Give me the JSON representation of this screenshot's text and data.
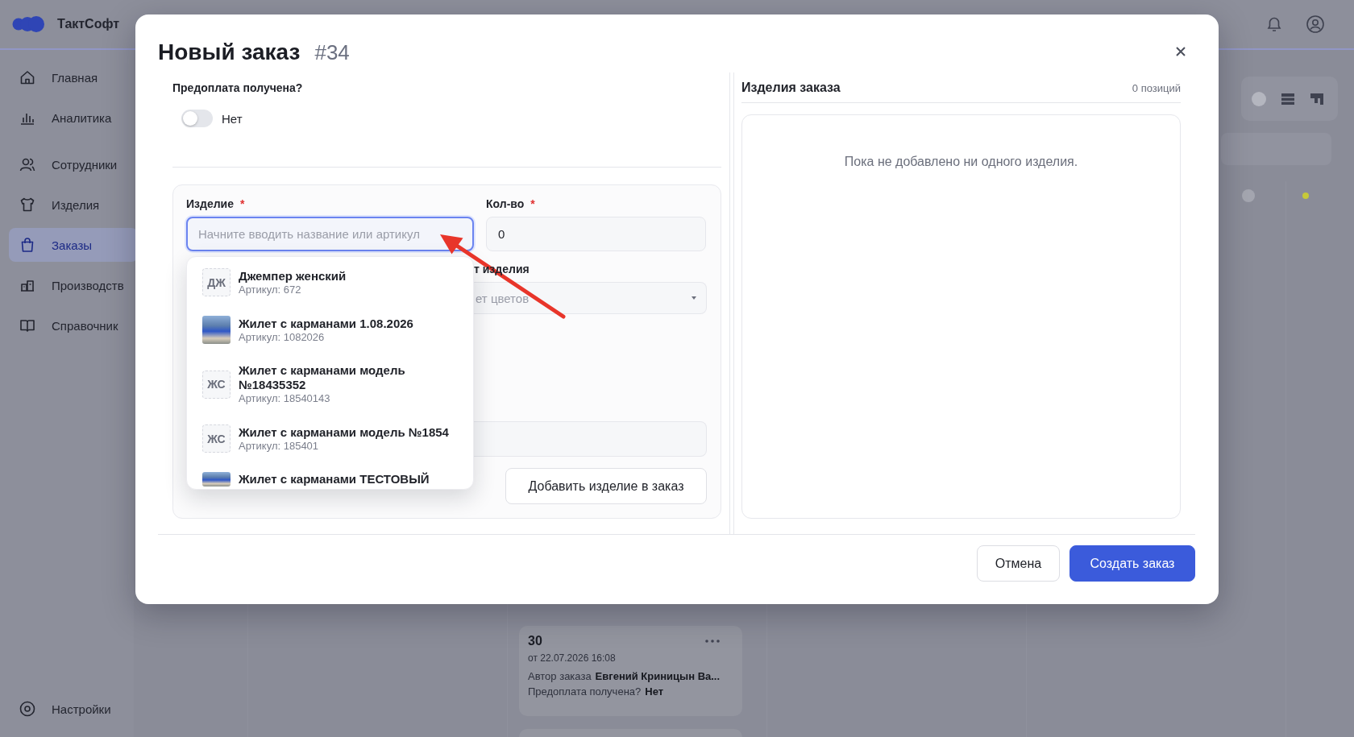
{
  "app": {
    "logo_text": "ТактСофт",
    "sidebar": {
      "groups": [
        {
          "items": [
            {
              "label": "Главная",
              "selected": false
            },
            {
              "label": "Аналитика",
              "selected": false
            }
          ]
        },
        {
          "items": [
            {
              "label": "Сотрудники",
              "selected": false
            },
            {
              "label": "Изделия",
              "selected": false
            },
            {
              "label": "Заказы",
              "selected": true
            },
            {
              "label": "Производств",
              "selected": false
            },
            {
              "label": "Справочник",
              "selected": false
            }
          ]
        }
      ],
      "settings": {
        "label": "Настройки"
      }
    },
    "board": {
      "order_card": {
        "number": "30",
        "date": "от 22.07.2026 16:08",
        "author_label": "Автор заказа",
        "author": "Евгений Криницын Ва...",
        "prepay_label": "Предоплата получена?",
        "prepay_value": "Нет"
      }
    }
  },
  "dialog": {
    "title": "Новый заказ",
    "number": "#34",
    "prepayment": {
      "label": "Предоплата получена?",
      "on": false,
      "state_text": "Нет"
    },
    "item_form": {
      "product": {
        "label": "Изделие",
        "required_mark": "*",
        "placeholder": "Начните вводить название или артикул",
        "focused": true
      },
      "quantity": {
        "label": "Кол-во",
        "required_mark": "*",
        "value": "0"
      },
      "color": {
        "label": "т изделия",
        "placeholder": "ет цветов"
      },
      "add_button": "Добавить изделие в заказ",
      "suggestions": [
        {
          "kind": "initials",
          "initials": "ДЖ",
          "name": "Джемпер женский",
          "article": "Артикул: 672",
          "cut_off": false
        },
        {
          "kind": "photo",
          "name": "Жилет с карманами 1.08.2026",
          "article": "Артикул: 1082026",
          "cut_off": false
        },
        {
          "kind": "initials",
          "initials": "ЖС",
          "name": "Жилет с карманами модель №18435352",
          "article": "Артикул: 18540143",
          "cut_off": false
        },
        {
          "kind": "initials",
          "initials": "ЖС",
          "name": "Жилет с карманами модель №1854",
          "article": "Артикул: 185401",
          "cut_off": false
        },
        {
          "kind": "photo",
          "name": "Жилет с карманами ТЕСТОВЫЙ",
          "cut_off": true
        }
      ]
    },
    "order_items": {
      "title": "Изделия заказа",
      "count": "0 позиций",
      "empty_text": "Пока не добавлено ни одного изделия."
    },
    "buttons": [
      {
        "label": "Отмена",
        "kind": "secondary"
      },
      {
        "label": "Создать заказ",
        "kind": "primary"
      }
    ]
  },
  "annotation": {
    "kind": "arrow"
  }
}
